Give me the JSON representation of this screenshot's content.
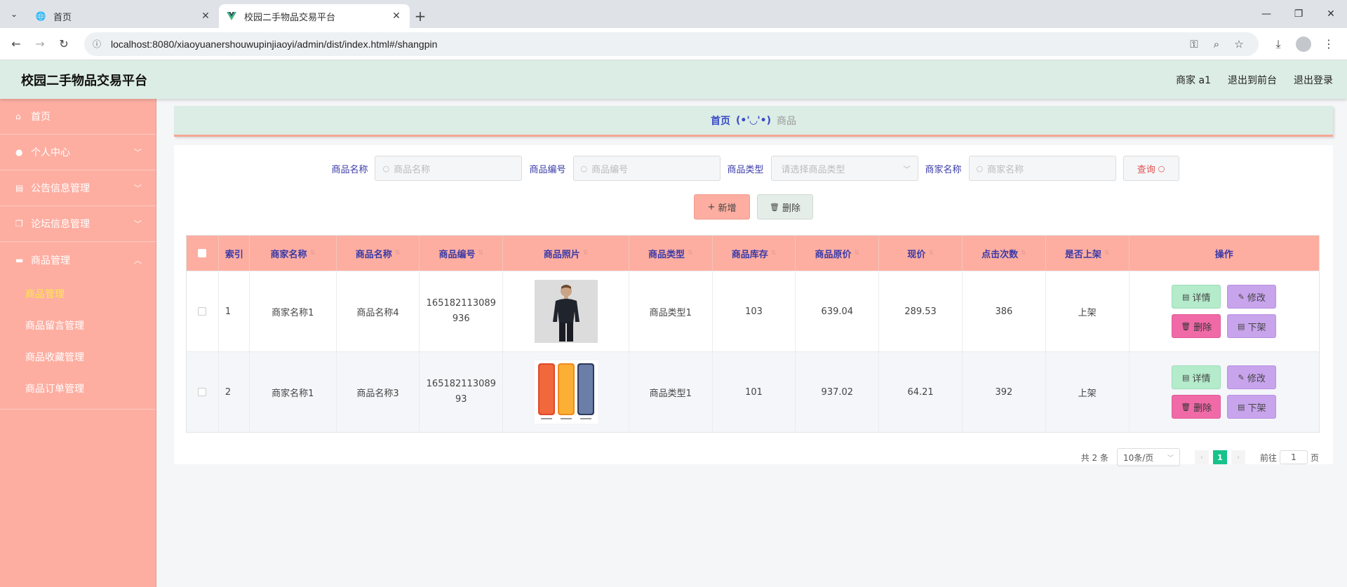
{
  "browser": {
    "tabs": [
      {
        "title": "首页",
        "active": false
      },
      {
        "title": "校园二手物品交易平台",
        "active": true
      }
    ],
    "url": "localhost:8080/xiaoyuanershouwupinjiaoyi/admin/dist/index.html#/shangpin"
  },
  "header": {
    "title": "校园二手物品交易平台",
    "user": "商家 a1",
    "to_front": "退出到前台",
    "logout": "退出登录"
  },
  "sidebar": {
    "items": [
      {
        "label": "首页",
        "icon": "home-icon"
      },
      {
        "label": "个人中心",
        "icon": "user-icon"
      },
      {
        "label": "公告信息管理",
        "icon": "clipboard-icon"
      },
      {
        "label": "论坛信息管理",
        "icon": "copy-icon"
      },
      {
        "label": "商品管理",
        "icon": "monitor-icon"
      }
    ],
    "sub_items": [
      {
        "label": "商品管理",
        "active": true
      },
      {
        "label": "商品留言管理",
        "active": false
      },
      {
        "label": "商品收藏管理",
        "active": false
      },
      {
        "label": "商品订单管理",
        "active": false
      }
    ]
  },
  "breadcrumb": {
    "home": "首页",
    "separator": "(•'◡'•)",
    "current": "商品"
  },
  "search": {
    "fields": [
      {
        "label": "商品名称",
        "placeholder": "商品名称"
      },
      {
        "label": "商品编号",
        "placeholder": "商品编号"
      },
      {
        "label": "商品类型",
        "placeholder": "请选择商品类型"
      },
      {
        "label": "商家名称",
        "placeholder": "商家名称"
      }
    ],
    "query_button": "查询"
  },
  "actions": {
    "add": "新增",
    "delete": "删除"
  },
  "table": {
    "columns": [
      "索引",
      "商家名称",
      "商品名称",
      "商品编号",
      "商品照片",
      "商品类型",
      "商品库存",
      "商品原价",
      "现价",
      "点击次数",
      "是否上架",
      "操作"
    ],
    "rows": [
      {
        "index": "1",
        "shop": "商家名称1",
        "name": "商品名称4",
        "code": "165182113089936",
        "photo": "black-jacket-photo",
        "type": "商品类型1",
        "stock": "103",
        "orig_price": "639.04",
        "price": "289.53",
        "clicks": "386",
        "status": "上架"
      },
      {
        "index": "2",
        "shop": "商家名称1",
        "name": "商品名称3",
        "code": "16518211308993",
        "photo": "phones-photo",
        "type": "商品类型1",
        "stock": "101",
        "orig_price": "937.02",
        "price": "64.21",
        "clicks": "392",
        "status": "上架"
      }
    ],
    "op_labels": {
      "detail": "详情",
      "edit": "修改",
      "delete": "删除",
      "off_shelf": "下架"
    }
  },
  "pagination": {
    "total": "共 2 条",
    "page_size": "10条/页",
    "current_page": "1",
    "goto_prefix": "前往",
    "goto_value": "1",
    "goto_suffix": "页"
  },
  "colors": {
    "sidebar_bg": "#fdaea1",
    "header_bg": "#dcede5",
    "accent_text": "#3a3aa8",
    "active_submenu": "#ffe94a",
    "page_active": "#17c38a"
  }
}
